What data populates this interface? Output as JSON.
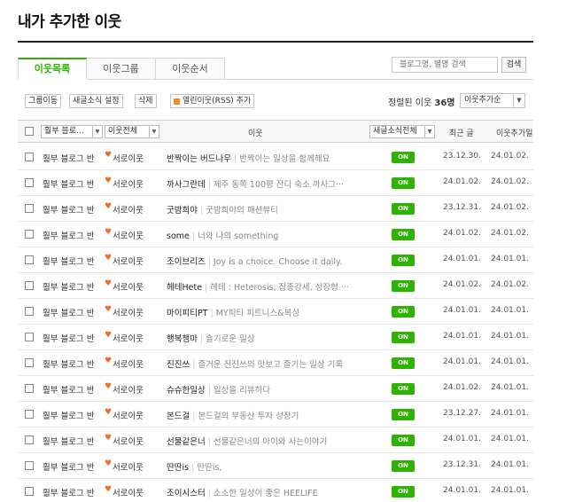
{
  "title": "내가 추가한 이웃",
  "tabs": [
    "이웃목록",
    "이웃그룹",
    "이웃순서"
  ],
  "search": {
    "placeholder": "블로그명, 별명 검색",
    "button": "검색"
  },
  "toolbar": {
    "group_move": "그룹이동",
    "news_setting": "새글소식 설정",
    "delete": "삭제",
    "rss_add": "열린이웃(RSS) 추가"
  },
  "sort": {
    "label_prefix": "정렬된 이웃",
    "count": "36명",
    "selected": "이웃추가순"
  },
  "header": {
    "group_filter": "훨부 블로...",
    "relation_filter": "이웃전체",
    "neighbor_col": "이웃",
    "news_filter": "새글소식전체",
    "recent_post": "최근 글",
    "added_date": "이웃추가일"
  },
  "colors": {
    "accent": "#2db400",
    "heart": "#f36a2a",
    "rss": "#f68b1f"
  },
  "rows": [
    {
      "group": "훨부 블로그 반",
      "relation": "서로이웃",
      "name": "반짝이는 버드나무",
      "desc": "반짝이는 일상을 함께해요",
      "news": "ON",
      "recent": "23.12.30.",
      "added": "24.01.02."
    },
    {
      "group": "훨부 블로그 반",
      "relation": "서로이웃",
      "name": "까사그란데",
      "desc": "제주 동쪽 100평 잔디 숙소 까사그···",
      "news": "ON",
      "recent": "24.01.02.",
      "added": "24.01.02."
    },
    {
      "group": "훨부 블로그 반",
      "relation": "서로이웃",
      "name": "굿밤희야",
      "desc": "굿밤희야의 패션뷰티",
      "news": "ON",
      "recent": "23.12.31.",
      "added": "24.01.02."
    },
    {
      "group": "훨부 블로그 반",
      "relation": "서로이웃",
      "name": "some",
      "desc": "너와 나의 something",
      "news": "ON",
      "recent": "24.01.02.",
      "added": "24.01.02."
    },
    {
      "group": "훨부 블로그 반",
      "relation": "서로이웃",
      "name": "조이브리즈",
      "desc": "Joy is a choice. Choose it daily.",
      "news": "ON",
      "recent": "24.01.01.",
      "added": "24.01.01."
    },
    {
      "group": "훨부 블로그 반",
      "relation": "서로이웃",
      "name": "헤테Hete",
      "desc": "헤테 : Heterosis, 잡종강세, 성장형 ···",
      "news": "ON",
      "recent": "24.01.02.",
      "added": "24.01.02."
    },
    {
      "group": "훨부 블로그 반",
      "relation": "서로이웃",
      "name": "마이피티PT",
      "desc": "MY피티 피트니스&복싱",
      "news": "ON",
      "recent": "24.01.01.",
      "added": "24.01.01."
    },
    {
      "group": "훨부 블로그 반",
      "relation": "서로이웃",
      "name": "행복챔마",
      "desc": "슬기로운 일상",
      "news": "ON",
      "recent": "24.01.01.",
      "added": "24.01.01."
    },
    {
      "group": "훨부 블로그 반",
      "relation": "서로이웃",
      "name": "진진쓰",
      "desc": "즐거운 진진쓰의 맛보고 즐기는 일상 기록",
      "news": "ON",
      "recent": "24.01.01.",
      "added": "24.01.01."
    },
    {
      "group": "훨부 블로그 반",
      "relation": "서로이웃",
      "name": "슈슈한일상",
      "desc": "일상을 리뷰하다",
      "news": "ON",
      "recent": "24.01.02.",
      "added": "24.01.01."
    },
    {
      "group": "훨부 블로그 반",
      "relation": "서로이웃",
      "name": "본드걸",
      "desc": "본드걸의 부동산 투자 성장기",
      "news": "ON",
      "recent": "23.12.27.",
      "added": "24.01.01."
    },
    {
      "group": "훨부 블로그 반",
      "relation": "서로이웃",
      "name": "선물같은너",
      "desc": "선물같은너의 아이와 사는이야기",
      "news": "ON",
      "recent": "24.01.01.",
      "added": "24.01.01."
    },
    {
      "group": "훨부 블로그 반",
      "relation": "서로이웃",
      "name": "딴딴is",
      "desc": "딴딴is,",
      "news": "ON",
      "recent": "23.12.31.",
      "added": "24.01.01."
    },
    {
      "group": "훨부 블로그 반",
      "relation": "서로이웃",
      "name": "조이시스터",
      "desc": "소소한 일상이 좋은 HEELIFE",
      "news": "ON",
      "recent": "24.01.01.",
      "added": "24.01.01."
    }
  ]
}
